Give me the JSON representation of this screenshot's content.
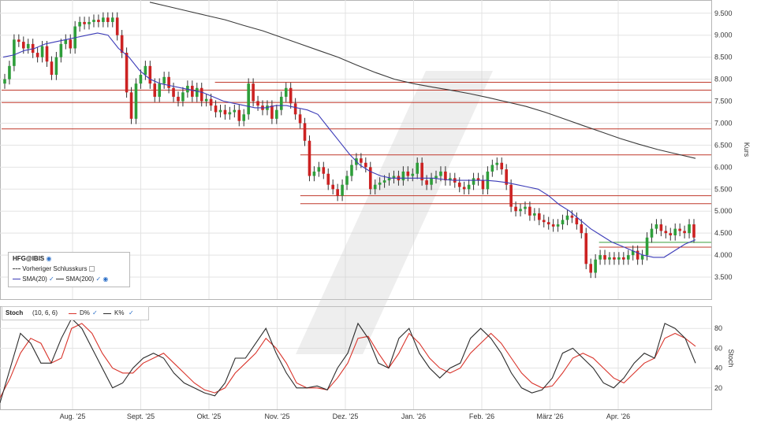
{
  "colors": {
    "up": "#2e9e3a",
    "down": "#cc2222",
    "sma20": "#3b3bb8",
    "sma200": "#3a3a3a",
    "hline": "#c0392b",
    "hline_green": "#3a9d3a",
    "d_line": "#d9342b",
    "k_line": "#2b2b2b",
    "grid": "#e3e3e3",
    "watermark": "#cfcfcf"
  },
  "legend": {
    "symbol": "HFG@IBIS",
    "prev_close": "Vorheriger Schlusskurs",
    "sma20": "SMA(20)",
    "sma200": "SMA(200)"
  },
  "stoch_legend": {
    "name": "Stoch",
    "params": "(10, 6, 6)",
    "d": "D%",
    "k": "K%"
  },
  "chart_data": [
    {
      "type": "candlestick",
      "ylabel": "Kurs",
      "ylim": [
        3.0,
        9.8
      ],
      "yticks": [
        "9.500",
        "9.000",
        "8.500",
        "8.000",
        "7.500",
        "7.000",
        "6.500",
        "6.000",
        "5.500",
        "5.000",
        "4.500",
        "4.000",
        "3.500"
      ],
      "ytick_values": [
        9.5,
        9.0,
        8.5,
        8.0,
        7.5,
        7.0,
        6.5,
        6.0,
        5.5,
        5.0,
        4.5,
        4.0,
        3.5
      ],
      "x_labels": [
        "Aug. '25",
        "Sept. '25",
        "Okt. '25",
        "Nov. '25",
        "Dez. '25",
        "Jan. '26",
        "Feb. '26",
        "März '26",
        "Apr. '26"
      ],
      "horizontal_lines": [
        {
          "value": 7.93,
          "from": 0.3
        },
        {
          "value": 7.75,
          "from": 0.0
        },
        {
          "value": 7.47,
          "from": 0.0
        },
        {
          "value": 6.87,
          "from": 0.0
        },
        {
          "value": 6.28,
          "from": 0.42
        },
        {
          "value": 5.35,
          "from": 0.42
        },
        {
          "value": 5.17,
          "from": 0.42
        },
        {
          "value": 4.29,
          "from": 0.84,
          "color": "green"
        },
        {
          "value": 4.18,
          "from": 0.84
        }
      ],
      "close": [
        8.0,
        8.3,
        8.9,
        8.85,
        8.7,
        8.8,
        8.6,
        8.5,
        8.75,
        8.4,
        8.1,
        8.5,
        8.8,
        8.9,
        8.7,
        9.2,
        9.3,
        9.25,
        9.3,
        9.35,
        9.3,
        9.4,
        9.3,
        9.4,
        9.0,
        8.6,
        7.7,
        7.1,
        7.9,
        8.1,
        8.3,
        7.9,
        7.6,
        7.9,
        8.05,
        7.8,
        7.6,
        7.5,
        7.7,
        7.85,
        7.6,
        7.8,
        7.5,
        7.55,
        7.4,
        7.25,
        7.3,
        7.2,
        7.25,
        7.3,
        7.05,
        7.2,
        7.9,
        7.5,
        7.4,
        7.3,
        7.4,
        7.1,
        7.3,
        7.6,
        7.8,
        7.45,
        7.2,
        7.0,
        6.6,
        5.8,
        5.9,
        6.0,
        5.85,
        5.6,
        5.5,
        5.35,
        5.6,
        5.8,
        6.05,
        6.2,
        6.1,
        6.0,
        5.5,
        5.6,
        5.65,
        5.7,
        5.75,
        5.8,
        5.7,
        5.9,
        5.8,
        5.85,
        6.1,
        5.7,
        5.6,
        5.75,
        5.8,
        5.9,
        5.7,
        5.75,
        5.65,
        5.55,
        5.5,
        5.6,
        5.75,
        5.7,
        5.5,
        5.9,
        6.05,
        6.1,
        5.95,
        5.6,
        5.1,
        5.0,
        5.05,
        5.1,
        4.9,
        4.95,
        4.8,
        4.75,
        4.7,
        4.65,
        4.7,
        4.8,
        4.9,
        4.85,
        4.7,
        4.5,
        3.8,
        3.6,
        3.9,
        4.0,
        3.9,
        3.95,
        3.9,
        3.95,
        3.9,
        4.0,
        4.1,
        3.9,
        4.0,
        4.4,
        4.6,
        4.7,
        4.55,
        4.5,
        4.45,
        4.6,
        4.55,
        4.5,
        4.7,
        4.4
      ],
      "series": [
        {
          "name": "SMA(20)",
          "values": [
            8.5,
            8.55,
            8.65,
            8.7,
            8.8,
            8.85,
            8.9,
            8.95,
            9.0,
            9.05,
            9.0,
            8.7,
            8.5,
            8.2,
            8.0,
            7.9,
            7.85,
            7.8,
            7.75,
            7.7,
            7.6,
            7.5,
            7.45,
            7.4,
            7.35,
            7.35,
            7.4,
            7.4,
            7.35,
            7.3,
            7.2,
            6.9,
            6.6,
            6.3,
            6.05,
            5.9,
            5.8,
            5.75,
            5.75,
            5.75,
            5.75,
            5.75,
            5.72,
            5.7,
            5.7,
            5.7,
            5.7,
            5.68,
            5.65,
            5.6,
            5.55,
            5.5,
            5.35,
            5.15,
            5.0,
            4.8,
            4.6,
            4.45,
            4.3,
            4.2,
            4.1,
            4.0,
            3.95,
            3.95,
            4.1,
            4.25,
            4.35
          ]
        },
        {
          "name": "SMA(200)",
          "values": [
            9.75,
            9.65,
            9.55,
            9.45,
            9.35,
            9.22,
            9.1,
            8.95,
            8.8,
            8.65,
            8.5,
            8.32,
            8.15,
            8.0,
            7.9,
            7.82,
            7.75,
            7.67,
            7.58,
            7.48,
            7.38,
            7.25,
            7.1,
            6.95,
            6.8,
            6.65,
            6.52,
            6.4,
            6.3,
            6.2
          ]
        },
        {
          "name": "D%",
          "values": [
            10,
            30,
            55,
            70,
            65,
            45,
            50,
            80,
            85,
            75,
            55,
            40,
            35,
            35,
            45,
            50,
            55,
            45,
            35,
            25,
            18,
            15,
            20,
            35,
            45,
            55,
            70,
            60,
            45,
            25,
            20,
            20,
            18,
            30,
            45,
            70,
            72,
            55,
            40,
            55,
            75,
            65,
            50,
            40,
            35,
            40,
            55,
            65,
            75,
            65,
            50,
            35,
            25,
            20,
            22,
            35,
            50,
            55,
            50,
            40,
            30,
            25,
            35,
            45,
            50,
            70,
            75,
            70,
            62
          ]
        },
        {
          "name": "K%",
          "values": [
            5,
            40,
            75,
            65,
            45,
            45,
            70,
            90,
            80,
            60,
            40,
            20,
            25,
            40,
            50,
            55,
            50,
            35,
            25,
            20,
            15,
            12,
            25,
            50,
            50,
            65,
            80,
            55,
            35,
            20,
            20,
            22,
            18,
            40,
            55,
            85,
            70,
            45,
            40,
            70,
            80,
            55,
            40,
            30,
            40,
            45,
            70,
            80,
            70,
            55,
            35,
            20,
            15,
            18,
            30,
            55,
            60,
            50,
            40,
            25,
            20,
            30,
            45,
            55,
            50,
            85,
            80,
            70,
            45
          ]
        }
      ]
    },
    {
      "type": "line",
      "ylabel": "Stoch",
      "ylim": [
        0,
        100
      ],
      "yticks": [
        "80",
        "60",
        "40",
        "20"
      ],
      "ytick_values": [
        80,
        60,
        40,
        20
      ]
    }
  ]
}
